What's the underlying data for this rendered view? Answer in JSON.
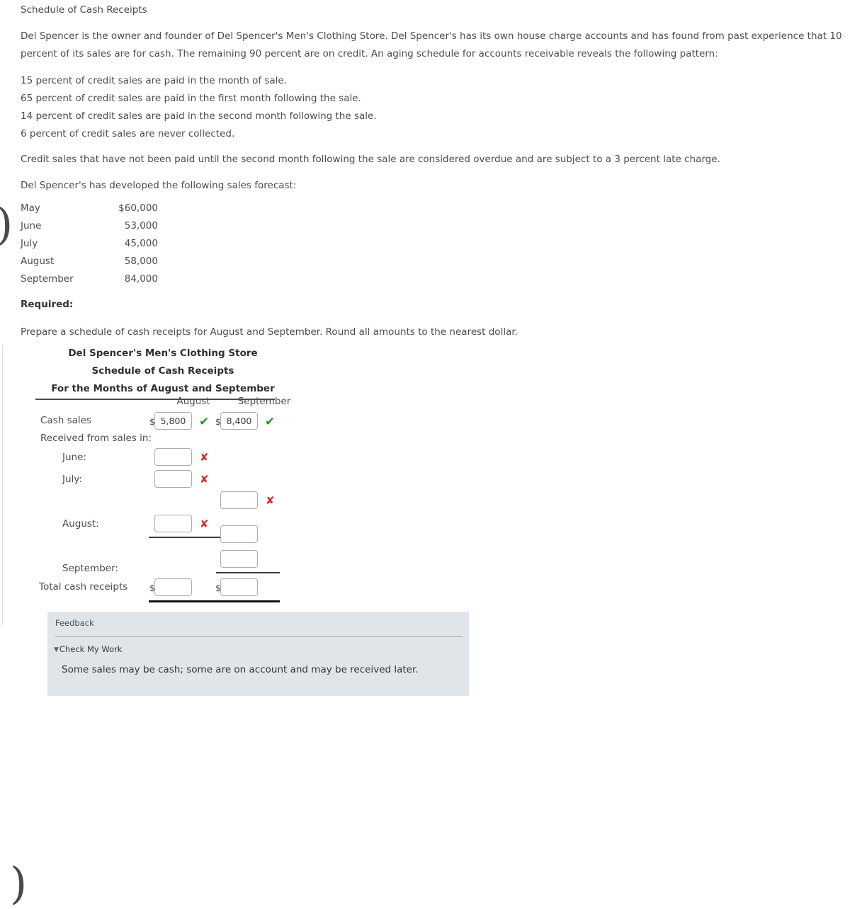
{
  "problem": {
    "title": "Schedule of Cash Receipts",
    "intro": "Del Spencer is the owner and founder of Del Spencer's Men's Clothing Store. Del Spencer's has its own house charge accounts and has found from past experience that 10 percent of its sales are for cash. The remaining 90 percent are on credit. An aging schedule for accounts receivable reveals the following pattern:",
    "bullets": [
      "15 percent of credit sales are paid in the month of sale.",
      "65 percent of credit sales are paid in the first month following the sale.",
      "14 percent of credit sales are paid in the second month following the sale.",
      "6 percent of credit sales are never collected."
    ],
    "overdue_note": "Credit sales that have not been paid until the second month following the sale are considered overdue and are subject to a 3 percent late charge.",
    "forecast_intro": "Del Spencer's has developed the following sales forecast:",
    "required_label": "Required:",
    "required_text": "Prepare a schedule of cash receipts for August and September. Round all amounts to the nearest dollar."
  },
  "forecast": {
    "rows": [
      {
        "month": "May",
        "amount": "$60,000"
      },
      {
        "month": "June",
        "amount": "53,000"
      },
      {
        "month": "July",
        "amount": "45,000"
      },
      {
        "month": "August",
        "amount": "58,000"
      },
      {
        "month": "September",
        "amount": "84,000"
      }
    ]
  },
  "sheet": {
    "title_line1": "Del Spencer's Men's Clothing Store",
    "title_line2": "Schedule of Cash Receipts",
    "title_line3": "For the Months of August and September",
    "columns": {
      "august": "August",
      "september": "September"
    },
    "currency_symbol": "$",
    "labels": {
      "cash_sales": "Cash sales",
      "received_from": "Received from sales in:",
      "june": "June:",
      "july": "July:",
      "august": "August:",
      "september": "September:",
      "total": "Total cash receipts"
    },
    "fields": {
      "cash_sales_aug": {
        "value": "5,800",
        "status": "correct"
      },
      "cash_sales_sep": {
        "value": "8,400",
        "status": "correct"
      },
      "june_aug": {
        "value": "",
        "status": "incorrect"
      },
      "july_aug": {
        "value": "",
        "status": "incorrect"
      },
      "july_sep": {
        "value": "",
        "status": "incorrect"
      },
      "august_aug": {
        "value": "",
        "status": "incorrect"
      },
      "august_sep": {
        "value": "",
        "status": "none"
      },
      "september_sep": {
        "value": "",
        "status": "none"
      },
      "total_aug": {
        "value": "",
        "status": "none"
      },
      "total_sep": {
        "value": "",
        "status": "none"
      }
    },
    "marks": {
      "correct": "✔",
      "incorrect": "✘"
    }
  },
  "feedback": {
    "label": "Feedback",
    "check_my_work": "Check My Work",
    "caret": "▼",
    "body": "Some sales may be cash; some are on account and may be received later."
  }
}
